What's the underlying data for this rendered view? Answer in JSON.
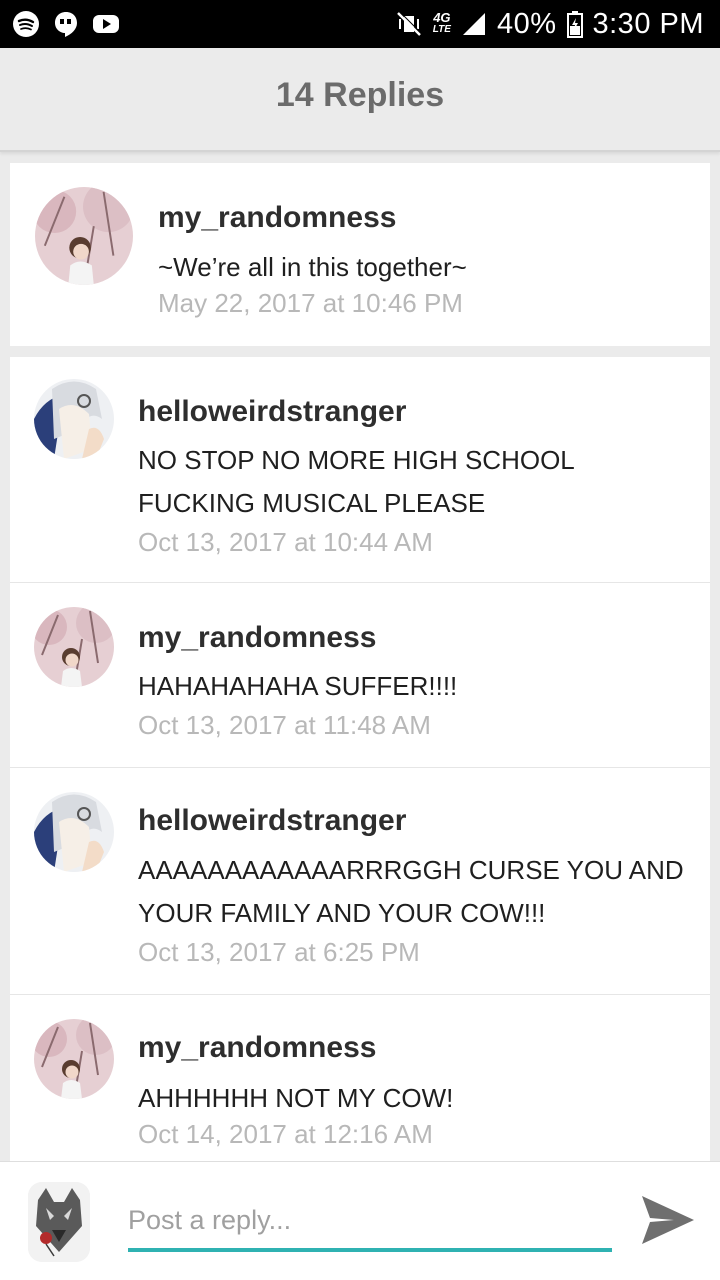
{
  "status_bar": {
    "battery": "40%",
    "time": "3:30 PM",
    "network": "4G",
    "network_sub": "LTE"
  },
  "header": {
    "title": "14 Replies"
  },
  "original_post": {
    "username": "my_randomness",
    "text": "~We’re all in this together~",
    "timestamp": "May 22, 2017 at 10:46 PM"
  },
  "replies": [
    {
      "username": "helloweirdstranger",
      "line1": "NO STOP NO MORE HIGH SCHOOL",
      "line2": "FUCKING MUSICAL PLEASE",
      "timestamp": "Oct 13, 2017 at 10:44 AM"
    },
    {
      "username": "my_randomness",
      "line1": "HAHAHAHAHA SUFFER!!!!",
      "timestamp": "Oct 13, 2017 at 11:48 AM"
    },
    {
      "username": "helloweirdstranger",
      "line1": "AAAAAAAAAAAARRRGGH CURSE YOU AND",
      "line2": "YOUR FAMILY AND YOUR COW!!!",
      "timestamp": "Oct 13, 2017 at 6:25 PM"
    },
    {
      "username": "my_randomness",
      "line1": "AHHHHHH NOT MY COW!",
      "timestamp": "Oct 14, 2017 at 12:16 AM"
    }
  ],
  "composer": {
    "placeholder": "Post a reply..."
  },
  "colors": {
    "accent": "#2fb2b2",
    "header_text": "#6b6b6b",
    "timestamp": "#b8b8b8"
  }
}
